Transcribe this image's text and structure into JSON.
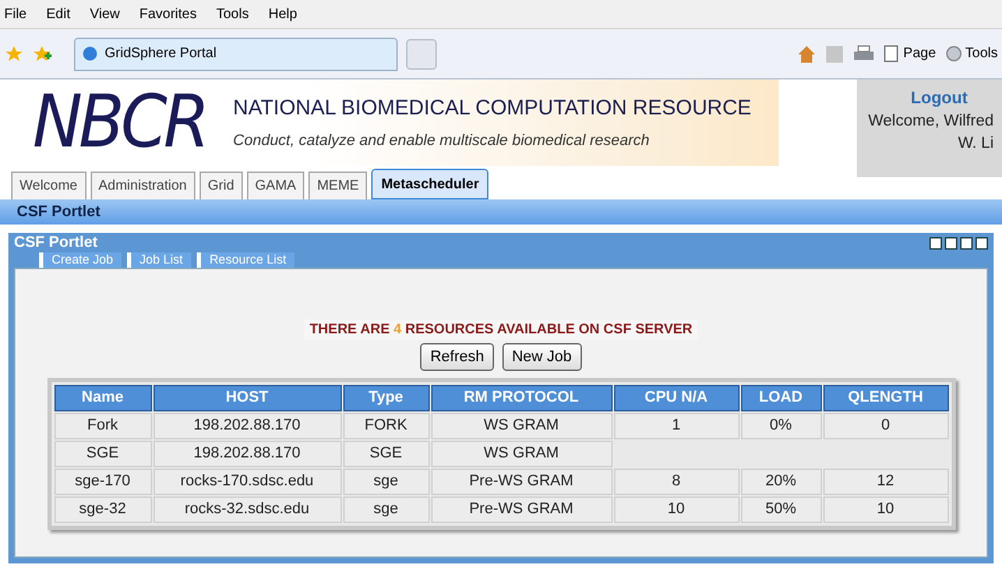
{
  "menu_bar": [
    "File",
    "Edit",
    "View",
    "Favorites",
    "Tools",
    "Help"
  ],
  "browser_tab": {
    "title": "GridSphere Portal"
  },
  "command_bar": {
    "page": "Page",
    "tools": "Tools"
  },
  "banner": {
    "logo": "NBCR",
    "title": "NATIONAL BIOMEDICAL COMPUTATION RESOURCE",
    "subtitle": "Conduct, catalyze and enable multiscale biomedical research"
  },
  "user_box": {
    "logout": "Logout",
    "welcome": "Welcome, Wilfred W. Li"
  },
  "tabs": [
    {
      "label": "Welcome",
      "selected": false
    },
    {
      "label": "Administration",
      "selected": false
    },
    {
      "label": "Grid",
      "selected": false
    },
    {
      "label": "GAMA",
      "selected": false
    },
    {
      "label": "MEME",
      "selected": false
    },
    {
      "label": "Metascheduler",
      "selected": true
    }
  ],
  "section_bar": {
    "title": "CSF Portlet"
  },
  "portlet": {
    "title": "CSF Portlet",
    "tabs": [
      {
        "label": "Create Job",
        "selected": false
      },
      {
        "label": "Job List",
        "selected": false
      },
      {
        "label": "Resource List",
        "selected": false
      }
    ],
    "heading": {
      "before": "THERE ARE",
      "count": "4",
      "after": "RESOURCES AVAILABLE ON CSF SERVER"
    },
    "buttons": [
      "Refresh",
      "New Job"
    ],
    "table": {
      "columns": [
        "Name",
        "HOST",
        "Type",
        "RM PROTOCOL",
        "CPU N/A",
        "LOAD",
        "QLENGTH"
      ],
      "rows": [
        [
          "Fork",
          "198.202.88.170",
          "FORK",
          "WS GRAM",
          "1",
          "0%",
          "0"
        ],
        [
          "SGE",
          "198.202.88.170",
          "SGE",
          "WS GRAM"
        ],
        [
          "sge-170",
          "rocks-170.sdsc.edu",
          "sge",
          "Pre-WS GRAM",
          "8",
          "20%",
          "12"
        ],
        [
          "sge-32",
          "rocks-32.sdsc.edu",
          "sge",
          "Pre-WS GRAM",
          "10",
          "50%",
          "10"
        ]
      ]
    }
  }
}
